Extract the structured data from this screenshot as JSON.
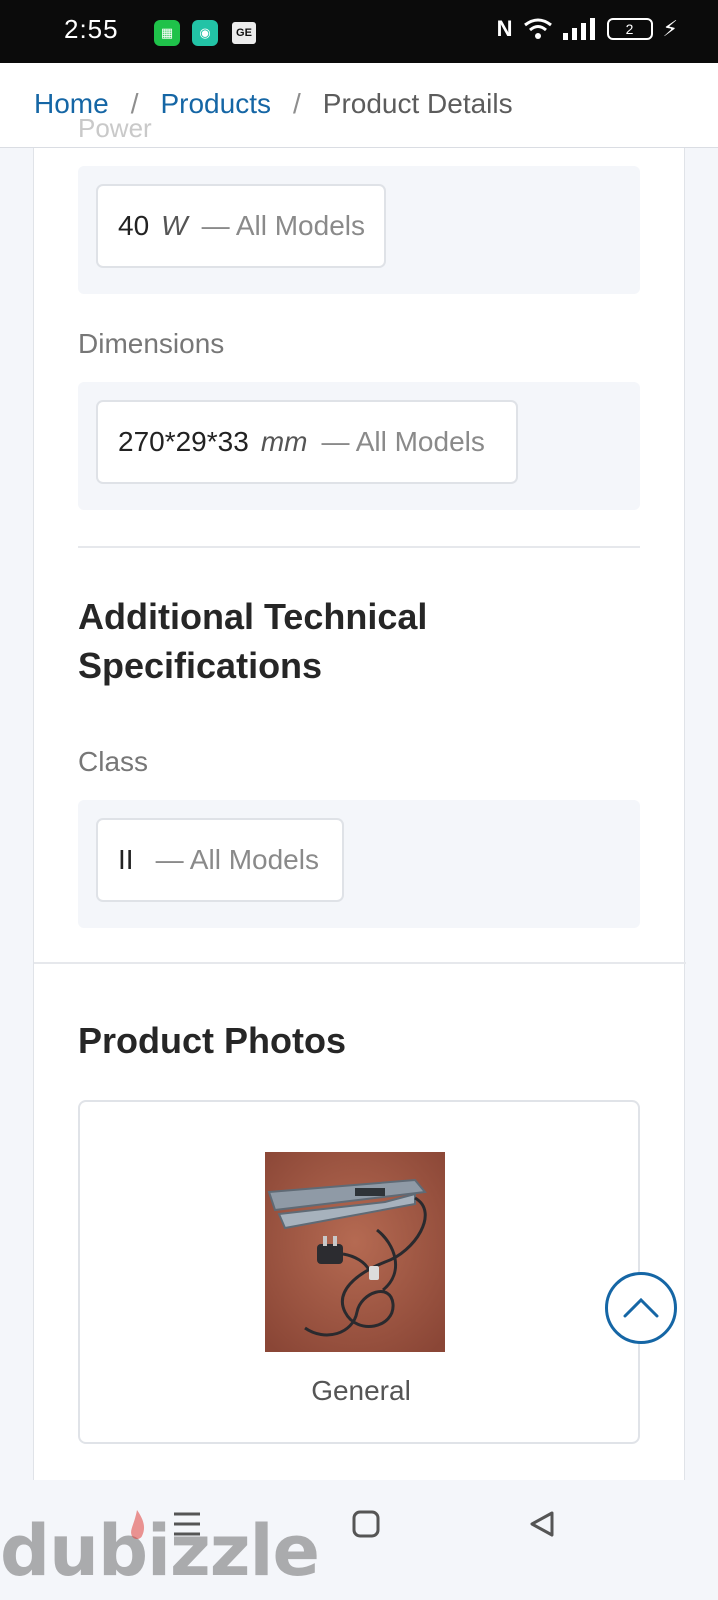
{
  "status_bar": {
    "time": "2:55",
    "battery": "2",
    "icons": [
      "app-green-icon",
      "app-teal-icon",
      "app-ge-icon",
      "nfc-icon",
      "wifi-icon",
      "signal-icon",
      "battery-icon",
      "charging-icon"
    ]
  },
  "breadcrumb": {
    "items": [
      "Home",
      "Products"
    ],
    "separator": "/",
    "current": "Product Details",
    "partial_label": "Power"
  },
  "specs": [
    {
      "value": "40",
      "unit": "W",
      "models": "— All Models"
    },
    {
      "label": "Dimensions",
      "value": "270*29*33",
      "unit": "mm",
      "models": "— All Models"
    }
  ],
  "additional": {
    "heading": "Additional Technical Specifications",
    "spec": {
      "label": "Class",
      "value": "II",
      "models": "— All Models"
    }
  },
  "photos": {
    "heading": "Product Photos",
    "items": [
      {
        "caption": "General"
      }
    ]
  },
  "watermark": "dubizzle",
  "colors": {
    "link": "#1566a5",
    "page_bg": "#f4f6fa",
    "accent_red": "#e0403a"
  }
}
